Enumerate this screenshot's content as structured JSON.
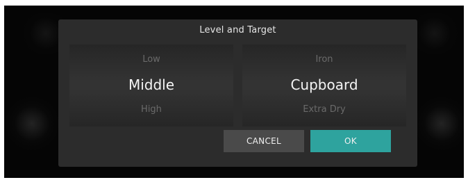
{
  "dialog": {
    "title": "Level and Target"
  },
  "level_picker": {
    "previous": "Low",
    "selected": "Middle",
    "next": "High"
  },
  "target_picker": {
    "previous": "Iron",
    "selected": "Cupboard",
    "next": "Extra Dry"
  },
  "buttons": {
    "cancel_label": "CANCEL",
    "ok_label": "OK"
  },
  "colors": {
    "dialog_background": "#2c2c2c",
    "ok_accent": "#2ea39e",
    "cancel_background": "#4a4a4a"
  }
}
